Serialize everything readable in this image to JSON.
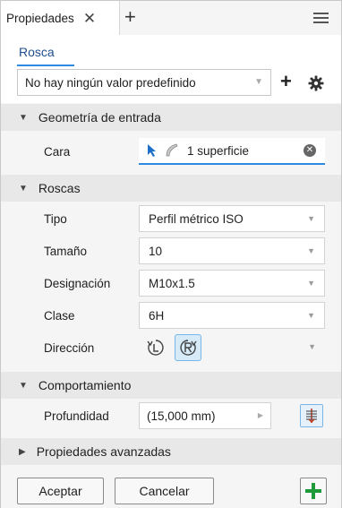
{
  "tab": {
    "label": "Propiedades",
    "close": "✕",
    "add": "+"
  },
  "preset": {
    "link": "Rosca",
    "selected": "No hay ningún valor predefinido",
    "add": "+"
  },
  "sections": {
    "input_geometry": {
      "title": "Geometría de entrada",
      "face_label": "Cara",
      "face_value": "1 superficie"
    },
    "threads": {
      "title": "Roscas",
      "type_label": "Tipo",
      "type_value": "Perfil métrico ISO",
      "size_label": "Tamaño",
      "size_value": "10",
      "designation_label": "Designación",
      "designation_value": "M10x1.5",
      "class_label": "Clase",
      "class_value": "6H",
      "direction_label": "Dirección"
    },
    "behavior": {
      "title": "Comportamiento",
      "depth_label": "Profundidad",
      "depth_value": "(15,000 mm)"
    },
    "advanced": {
      "title": "Propiedades avanzadas"
    }
  },
  "footer": {
    "accept": "Aceptar",
    "cancel": "Cancelar"
  },
  "colors": {
    "accent": "#2d8ae0",
    "apply_green": "#1f9a3a",
    "link": "#1f4f8f"
  },
  "icons": [
    "hamburger-menu-icon",
    "gear-icon",
    "select-arrow-icon",
    "face-selection-icon",
    "clear-icon",
    "left-hand-thread-icon",
    "right-hand-thread-icon",
    "depth-flip-icon",
    "apply-plus-icon"
  ]
}
